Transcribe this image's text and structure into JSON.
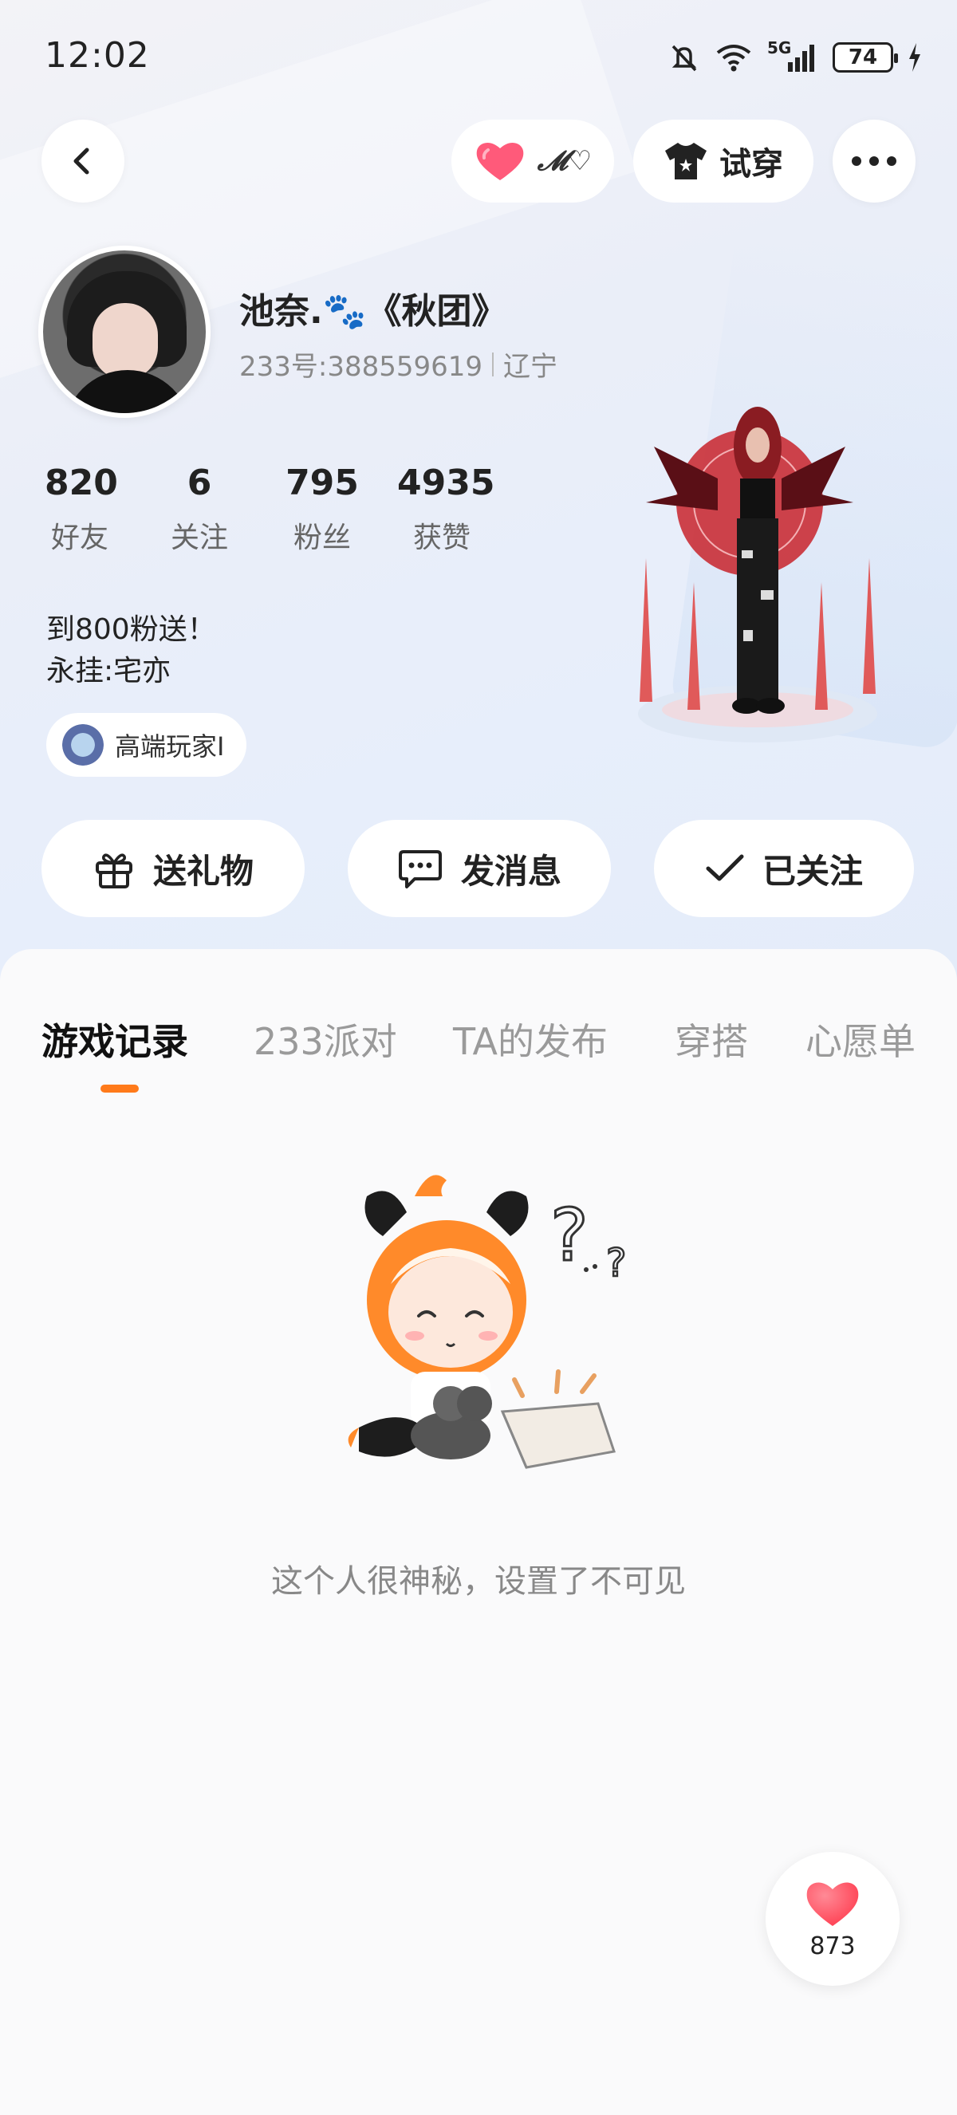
{
  "status_bar": {
    "time": "12:02",
    "battery": "74",
    "network": "5G"
  },
  "header": {
    "back_icon": "chevron-left-icon",
    "heart_tag": "𝓜♡",
    "try_on_label": "试穿",
    "more_icon": "ellipsis-icon"
  },
  "profile": {
    "name": "池奈.🐾《秋团》",
    "uid": "233号:388559619",
    "location": "辽宁",
    "stats": [
      {
        "value": "820",
        "label": "好友"
      },
      {
        "value": "6",
        "label": "关注"
      },
      {
        "value": "795",
        "label": "粉丝"
      },
      {
        "value": "4935",
        "label": "获赞"
      }
    ],
    "bio_lines": [
      "到800粉送！",
      "永挂:宅亦"
    ],
    "badge_label": "高端玩家I"
  },
  "actions": {
    "gift": "送礼物",
    "message": "发消息",
    "following": "已关注"
  },
  "tabs": [
    {
      "label": "游戏记录",
      "active": true
    },
    {
      "label": "233派对",
      "active": false
    },
    {
      "label": "TA的发布",
      "active": false
    },
    {
      "label": "穿搭",
      "active": false
    },
    {
      "label": "心愿单",
      "active": false
    }
  ],
  "empty_state": {
    "text": "这个人很神秘，设置了不可见"
  },
  "like_fab": {
    "count": "873"
  },
  "colors": {
    "accent": "#ff7a1a",
    "heart": "#ff4d5e"
  }
}
